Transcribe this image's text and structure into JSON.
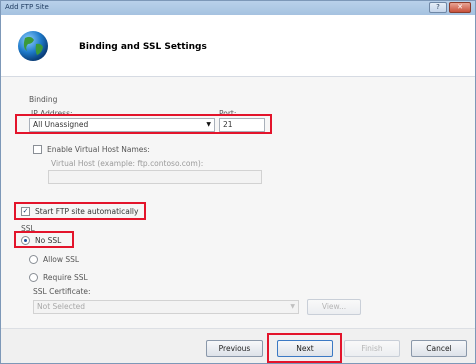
{
  "window": {
    "title": "Add FTP Site"
  },
  "title_buttons": {
    "minimize": "",
    "close": ""
  },
  "header": {
    "title": "Binding and SSL Settings"
  },
  "binding": {
    "group_label": "Binding",
    "ip_label": "IP Address:",
    "ip_value": "All Unassigned",
    "port_label": "Port:",
    "port_value": "21",
    "virtual_host_checkbox_label": "Enable Virtual Host Names:",
    "virtual_host_field_label": "Virtual Host (example: ftp.contoso.com):",
    "virtual_host_value": ""
  },
  "autostart": {
    "label": "Start FTP site automatically",
    "checked": true
  },
  "ssl": {
    "group_label": "SSL",
    "options": [
      "No SSL",
      "Allow SSL",
      "Require SSL"
    ],
    "selected": "No SSL",
    "cert_label": "SSL Certificate:",
    "cert_value": "Not Selected",
    "view_label": "View..."
  },
  "footer": {
    "previous_label": "Previous",
    "next_label": "Next",
    "finish_label": "Finish",
    "cancel_label": "Cancel"
  },
  "colors": {
    "highlight": "#e3142b",
    "title_text": "#1e3a5f"
  }
}
